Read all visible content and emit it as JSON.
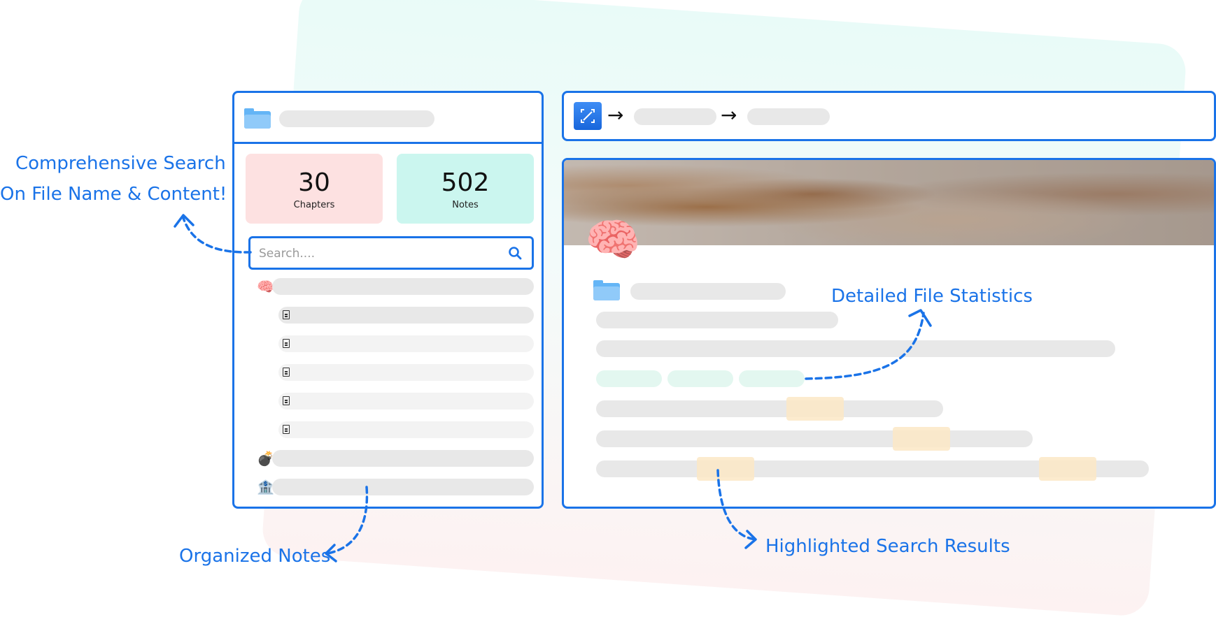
{
  "stats": {
    "chapters": {
      "value": "30",
      "label": "Chapters"
    },
    "notes": {
      "value": "502",
      "label": "Notes"
    }
  },
  "search": {
    "placeholder": "Search....",
    "value": ""
  },
  "tree": {
    "chapters": [
      {
        "emoji": "🧠",
        "notes": 5
      },
      {
        "emoji": "💣",
        "notes": 0
      },
      {
        "emoji": "🏦",
        "notes": 0
      }
    ]
  },
  "page": {
    "emoji": "🧠"
  },
  "annotations": {
    "search_line1": "Comprehensive Search",
    "search_line2": "On File Name & Content!",
    "organized": "Organized Notes",
    "statistics": "Detailed File Statistics",
    "highlighted": "Highlighted Search Results"
  },
  "colors": {
    "accent": "#1a73e8",
    "chapters_card": "#fde1e1",
    "notes_card": "#cbf6ef",
    "highlight": "#fbe8c5",
    "tag": "#e3f7f0"
  },
  "icons": [
    "folder-icon",
    "search-icon",
    "document-icon",
    "app-logo-icon",
    "arrow-right-icon"
  ]
}
